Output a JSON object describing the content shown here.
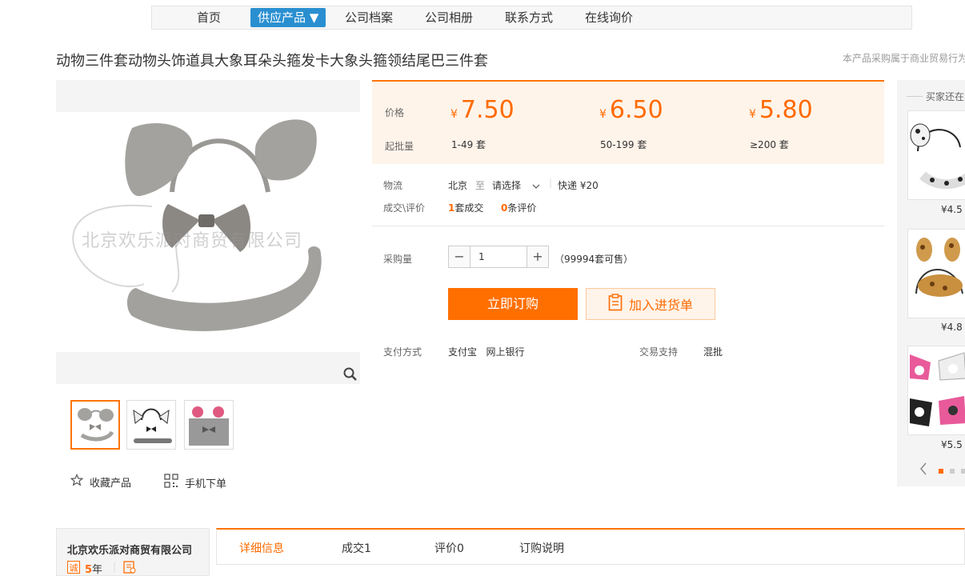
{
  "nav": {
    "items": [
      "首页",
      "供应产品 ▼",
      "公司档案",
      "公司相册",
      "联系方式",
      "在线询价"
    ]
  },
  "product": {
    "title": "动物三件套动物头饰道具大象耳朵头箍发卡大象头箍领结尾巴三件套",
    "notice": "本产品采购属于商业贸易行为",
    "watermark": "北京欢乐派对商贸有限公司"
  },
  "pricing": {
    "price_label": "价格",
    "moq_label": "起批量",
    "currency": "¥",
    "tiers": [
      {
        "price": "7.50",
        "range": "1-49 套"
      },
      {
        "price": "6.50",
        "range": "50-199 套"
      },
      {
        "price": "5.80",
        "range": "≥200 套"
      }
    ]
  },
  "logistics": {
    "label": "物流",
    "from": "北京",
    "to_word": "至",
    "select": "请选择",
    "express": "快递 ¥20"
  },
  "deals": {
    "label": "成交\\评价",
    "count": "1",
    "count_suffix": "套成交",
    "reviews": "0",
    "reviews_suffix": "条评价"
  },
  "purchase": {
    "label": "采购量",
    "quantity": "1",
    "available": "（99994套可售）",
    "buy_now": "立即订购",
    "add_cart": "加入进货单"
  },
  "payment": {
    "label": "支付方式",
    "methods": "支付宝   网上银行",
    "support_label": "交易支持",
    "support": "混批"
  },
  "actions": {
    "favorite": "收藏产品",
    "mobile": "手机下单"
  },
  "sidebar": {
    "title": "买家还在看",
    "items": [
      {
        "price": "¥4.5"
      },
      {
        "price": "¥4.8"
      },
      {
        "price": "¥5.5"
      }
    ]
  },
  "company": {
    "name": "北京欢乐派对商贸有限公司",
    "years": "5",
    "years_suffix": "年"
  },
  "tabs": [
    "详细信息",
    "成交1",
    "评价0",
    "订购说明"
  ],
  "colors": {
    "accent": "#ff6a00",
    "nav_active": "#2a8fd0"
  }
}
